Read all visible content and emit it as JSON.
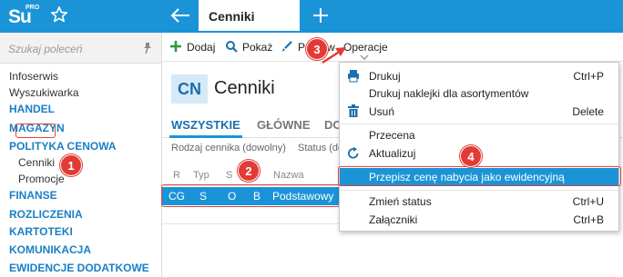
{
  "app": {
    "logo_main": "Su",
    "logo_sup": "PRO",
    "active_tab": "Cenniki"
  },
  "sidebar": {
    "search_placeholder": "Szukaj poleceń",
    "items": [
      {
        "label": "Infoserwis",
        "kind": "plain"
      },
      {
        "label": "Wyszukiwarka",
        "kind": "plain"
      },
      {
        "label": "HANDEL",
        "kind": "head"
      },
      {
        "label": "MAGAZYN",
        "kind": "head"
      },
      {
        "label": "POLITYKA CENOWA",
        "kind": "head"
      },
      {
        "label": "Cenniki",
        "kind": "sub"
      },
      {
        "label": "Promocje",
        "kind": "sub"
      },
      {
        "label": "FINANSE",
        "kind": "head"
      },
      {
        "label": "ROZLICZENIA",
        "kind": "head"
      },
      {
        "label": "KARTOTEKI",
        "kind": "head"
      },
      {
        "label": "KOMUNIKACJA",
        "kind": "head"
      },
      {
        "label": "EWIDENCJE DODATKOWE",
        "kind": "head"
      }
    ]
  },
  "toolbar": {
    "add_label": "Dodaj",
    "show_label": "Pokaż",
    "edit_label": "Popraw",
    "operations_label": "Operacje"
  },
  "header": {
    "badge": "CN",
    "title": "Cenniki"
  },
  "tabs": [
    "WSZYSTKIE",
    "GŁÓWNE",
    "DO"
  ],
  "filters": [
    "Rodzaj cennika (dowolny)",
    "Status (dow"
  ],
  "grid": {
    "columns": [
      "R",
      "Typ",
      "S",
      "",
      "Nazwa"
    ],
    "row": [
      "CG",
      "S",
      "O",
      "B",
      "Podstawowy"
    ]
  },
  "dropdown": {
    "items": [
      {
        "label": "Drukuj",
        "shortcut": "Ctrl+P",
        "icon": "printer-icon"
      },
      {
        "label": "Drukuj naklejki dla asortymentów",
        "shortcut": "",
        "icon": ""
      },
      {
        "label": "Usuń",
        "shortcut": "Delete",
        "icon": "trash-icon"
      },
      {
        "label": "Przecena",
        "shortcut": "",
        "icon": ""
      },
      {
        "label": "Aktualizuj",
        "shortcut": "",
        "icon": "refresh-icon"
      },
      {
        "label": "Przepisz cenę nabycia jako ewidencyjną",
        "shortcut": "",
        "icon": ""
      },
      {
        "label": "Zmień status",
        "shortcut": "Ctrl+U",
        "icon": ""
      },
      {
        "label": "Załączniki",
        "shortcut": "Ctrl+B",
        "icon": ""
      }
    ]
  },
  "markers": [
    "1",
    "2",
    "3",
    "4"
  ],
  "colors": {
    "brand_blue": "#1a94d6",
    "highlight_red": "#e0433f",
    "marker_red": "#e23b36",
    "section_blue": "#1a7fc6"
  }
}
